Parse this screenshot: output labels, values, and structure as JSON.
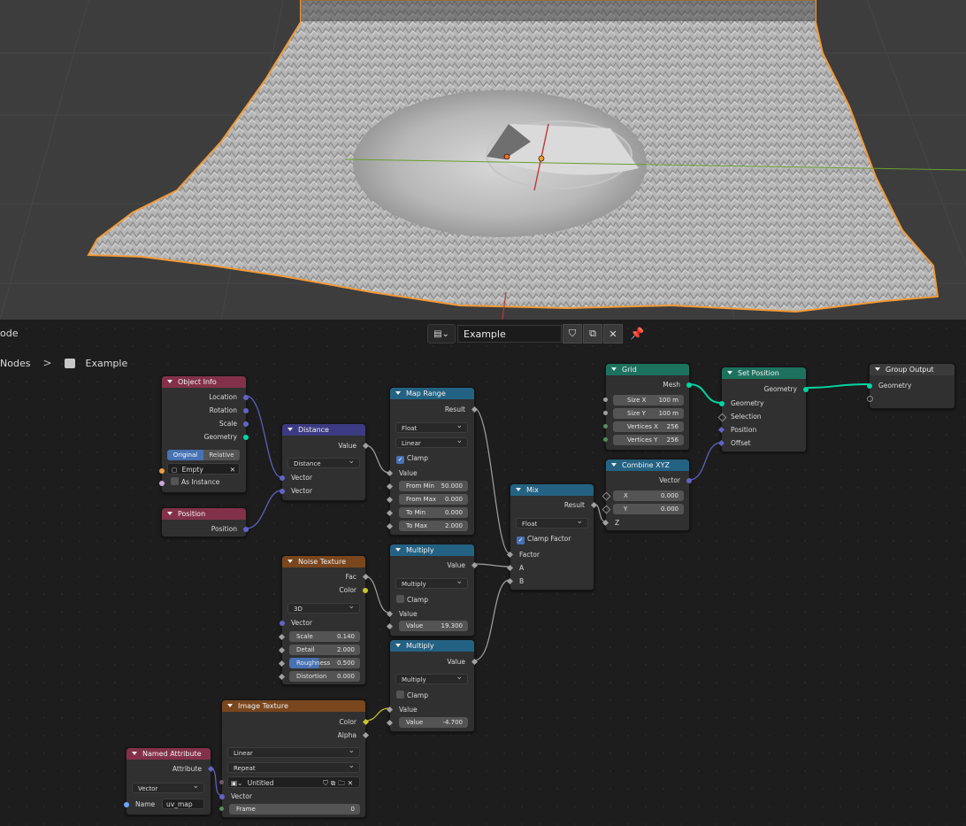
{
  "header": {
    "mode_label": "ode",
    "breadcrumb_root": "Nodes",
    "breadcrumb_sep": ">",
    "breadcrumb_tree": "Example",
    "datablock_name": "Example"
  },
  "nodes": {
    "object_info": {
      "title": "Object Info",
      "outs": [
        "Location",
        "Rotation",
        "Scale",
        "Geometry"
      ],
      "seg_original": "Original",
      "seg_relative": "Relative",
      "object_field": "Empty",
      "as_instance": "As Instance"
    },
    "position": {
      "title": "Position",
      "out": "Position"
    },
    "distance": {
      "title": "Distance",
      "out": "Value",
      "mode": "Distance",
      "in1": "Vector",
      "in2": "Vector"
    },
    "map_range": {
      "title": "Map Range",
      "out": "Result",
      "type": "Float",
      "interp": "Linear",
      "clamp": "Clamp",
      "in_value": "Value",
      "fields": [
        {
          "label": "From Min",
          "value": "50.000"
        },
        {
          "label": "From Max",
          "value": "0.000"
        },
        {
          "label": "To Min",
          "value": "0.000"
        },
        {
          "label": "To Max",
          "value": "2.000"
        }
      ]
    },
    "noise": {
      "title": "Noise Texture",
      "out_fac": "Fac",
      "out_color": "Color",
      "dim": "3D",
      "in_vector": "Vector",
      "fields": [
        {
          "label": "Scale",
          "value": "0.140"
        },
        {
          "label": "Detail",
          "value": "2.000"
        },
        {
          "label": "Roughness",
          "value": "0.500"
        },
        {
          "label": "Distortion",
          "value": "0.000"
        }
      ]
    },
    "multiply1": {
      "title": "Multiply",
      "out": "Value",
      "op": "Multiply",
      "clamp": "Clamp",
      "in_value": "Value",
      "field_label": "Value",
      "field_value": "19.300"
    },
    "multiply2": {
      "title": "Multiply",
      "out": "Value",
      "op": "Multiply",
      "clamp": "Clamp",
      "in_value": "Value",
      "field_label": "Value",
      "field_value": "-4.700"
    },
    "mix": {
      "title": "Mix",
      "out": "Result",
      "type": "Float",
      "clamp_factor": "Clamp Factor",
      "in_factor": "Factor",
      "in_a": "A",
      "in_b": "B"
    },
    "grid": {
      "title": "Grid",
      "out": "Mesh",
      "fields": [
        {
          "label": "Size X",
          "value": "100 m"
        },
        {
          "label": "Size Y",
          "value": "100 m"
        },
        {
          "label": "Vertices X",
          "value": "256"
        },
        {
          "label": "Vertices Y",
          "value": "256"
        }
      ]
    },
    "combine": {
      "title": "Combine XYZ",
      "out": "Vector",
      "fields": [
        {
          "label": "X",
          "value": "0.000"
        },
        {
          "label": "Y",
          "value": "0.000"
        }
      ],
      "in_z": "Z"
    },
    "set_position": {
      "title": "Set Position",
      "out": "Geometry",
      "ins": [
        "Geometry",
        "Selection",
        "Position",
        "Offset"
      ]
    },
    "group_output": {
      "title": "Group Output",
      "in": "Geometry"
    },
    "image_texture": {
      "title": "Image Texture",
      "out_color": "Color",
      "out_alpha": "Alpha",
      "interp": "Linear",
      "ext": "Repeat",
      "image": "Untitled",
      "in_vector": "Vector",
      "frame_label": "Frame",
      "frame_value": "0"
    },
    "named_attr": {
      "title": "Named Attribute",
      "out": "Attribute",
      "type": "Vector",
      "name_label": "Name",
      "name_value": "uv_map"
    }
  },
  "colors": {
    "geometry_header": "#1d725e",
    "input_header": "#83314a",
    "converter_header": "#246283",
    "vector_header": "#3b3b83",
    "texture_header": "#79461d",
    "output_header": "#3b3b3b"
  }
}
